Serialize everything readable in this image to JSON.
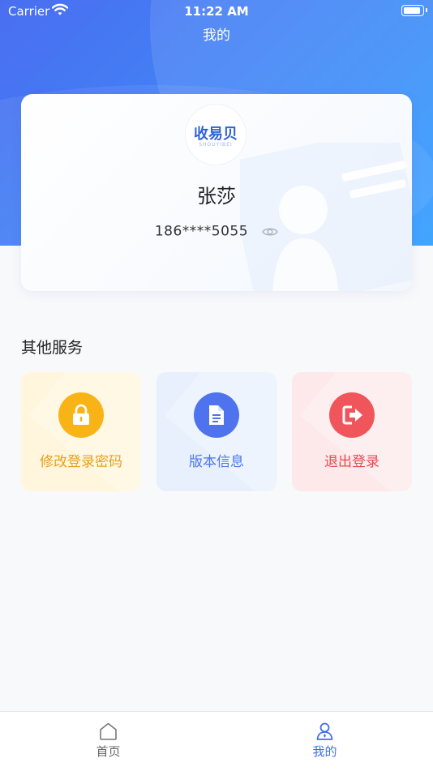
{
  "status_bar": {
    "carrier": "Carrier",
    "time": "11:22 AM"
  },
  "nav": {
    "title": "我的"
  },
  "profile": {
    "logo_text": "收易贝",
    "logo_sub": "SHOUYIBEI",
    "name": "张莎",
    "phone": "186****5055"
  },
  "services": {
    "title": "其他服务",
    "items": [
      {
        "label": "修改登录密码",
        "icon": "lock-icon",
        "color": "#f8b417"
      },
      {
        "label": "版本信息",
        "icon": "document-icon",
        "color": "#4f73ee"
      },
      {
        "label": "退出登录",
        "icon": "logout-icon",
        "color": "#f0555b"
      }
    ]
  },
  "tabbar": {
    "items": [
      {
        "label": "首页",
        "icon": "home-icon",
        "active": false
      },
      {
        "label": "我的",
        "icon": "user-icon",
        "active": true
      }
    ]
  },
  "colors": {
    "primary": "#3f6fe8",
    "hero_start": "#4a6ef0",
    "hero_end": "#2d9bff"
  }
}
